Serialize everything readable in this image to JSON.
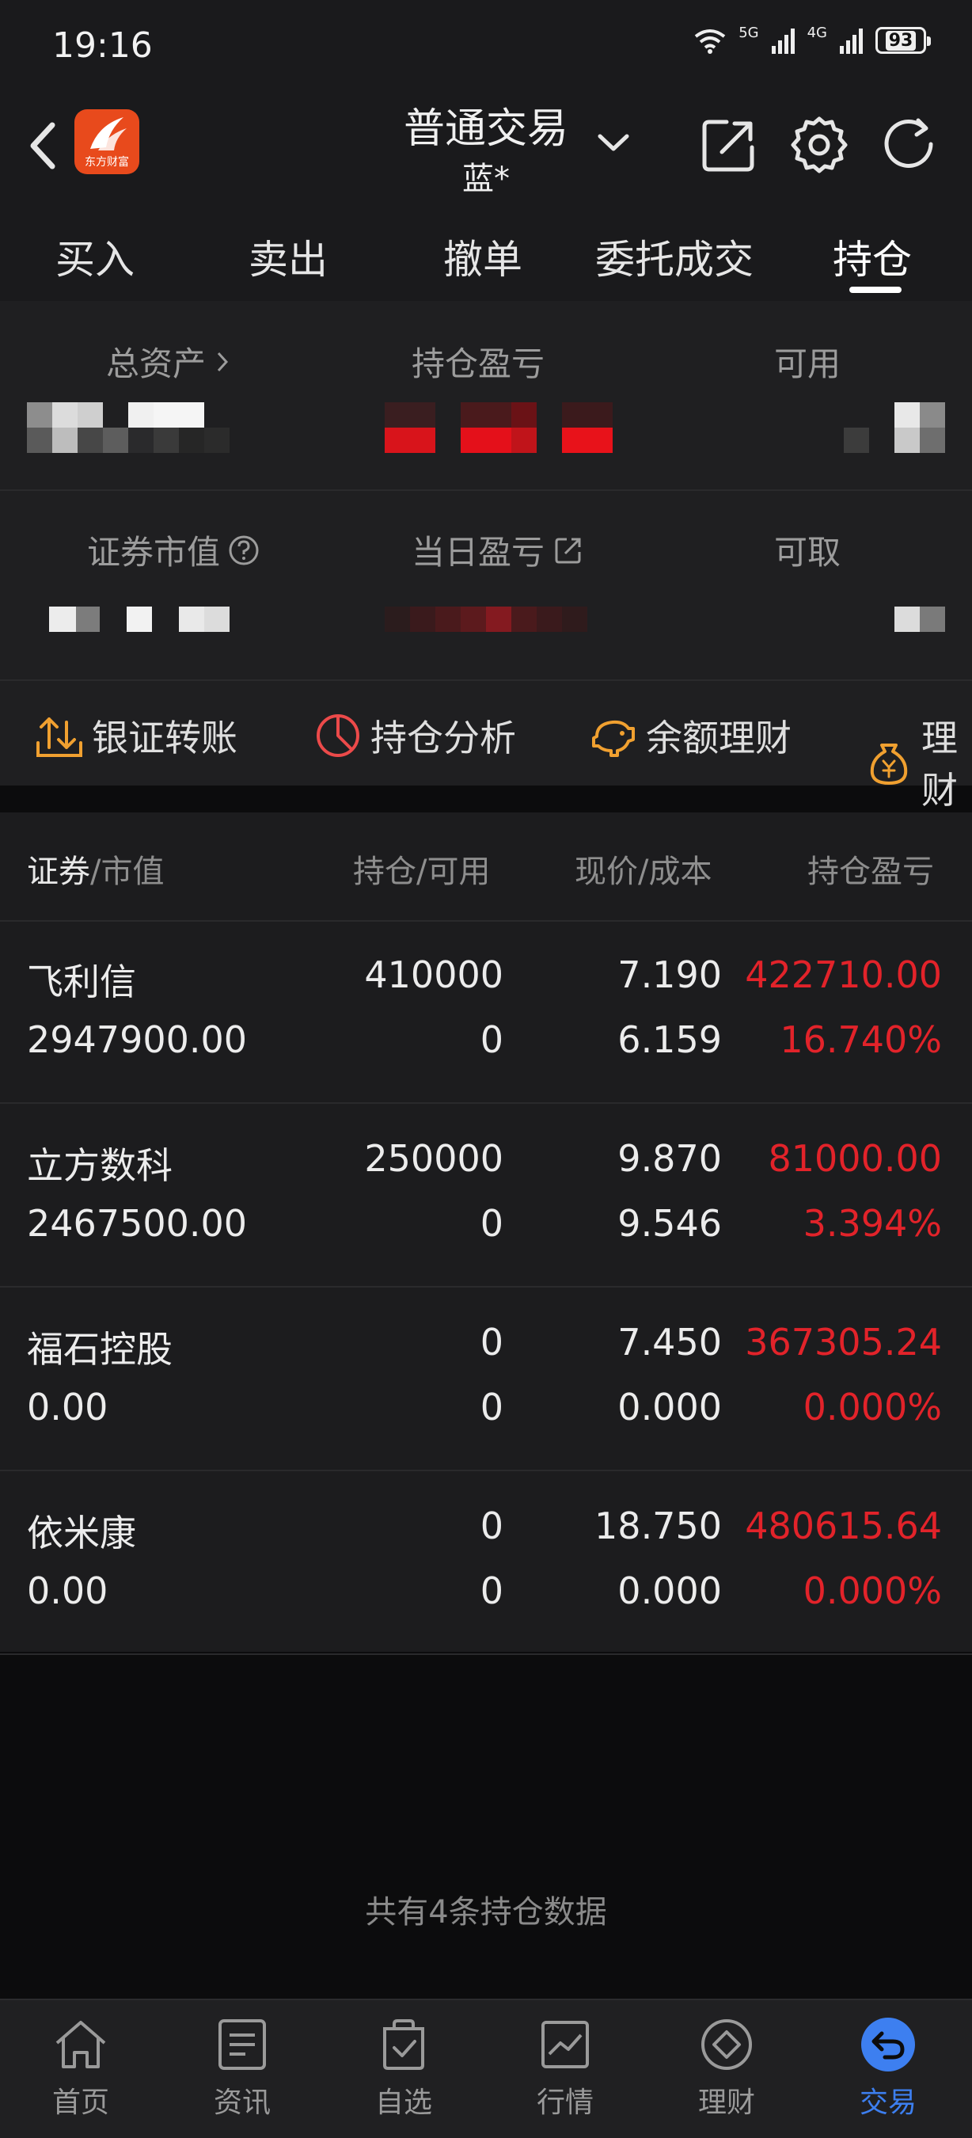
{
  "status_bar": {
    "time": "19:16",
    "net_a": "5G",
    "net_b": "4G",
    "battery": "93"
  },
  "header": {
    "title": "普通交易",
    "subtitle": "蓝*",
    "logo_text": "东方财富"
  },
  "tabs": [
    {
      "label": "买入"
    },
    {
      "label": "卖出"
    },
    {
      "label": "撤单"
    },
    {
      "label": "委托成交"
    },
    {
      "label": "持仓",
      "active": true
    }
  ],
  "summary": {
    "total_assets_label": "总资产",
    "position_pl_label": "持仓盈亏",
    "available_label": "可用",
    "market_value_label": "证券市值",
    "daily_pl_label": "当日盈亏",
    "withdrawable_label": "可取"
  },
  "quick_actions": [
    {
      "label": "银证转账",
      "icon": "transfer-icon"
    },
    {
      "label": "持仓分析",
      "icon": "pie-chart-icon"
    },
    {
      "label": "余额理财",
      "icon": "piggy-bank-icon"
    },
    {
      "label": "理财",
      "icon": "money-bag-icon"
    }
  ],
  "table": {
    "headers": {
      "security": "证券",
      "market_value": "/市值",
      "position": "持仓/可用",
      "price": "现价/成本",
      "pl": "持仓盈亏"
    },
    "rows": [
      {
        "name": "飞利信",
        "value": "2947900.00",
        "position": "410000",
        "available": "0",
        "price": "7.190",
        "cost": "6.159",
        "pl": "422710.00",
        "pl_pct": "16.740%"
      },
      {
        "name": "立方数科",
        "value": "2467500.00",
        "position": "250000",
        "available": "0",
        "price": "9.870",
        "cost": "9.546",
        "pl": "81000.00",
        "pl_pct": "3.394%"
      },
      {
        "name": "福石控股",
        "value": "0.00",
        "position": "0",
        "available": "0",
        "price": "7.450",
        "cost": "0.000",
        "pl": "367305.24",
        "pl_pct": "0.000%"
      },
      {
        "name": "依米康",
        "value": "0.00",
        "position": "0",
        "available": "0",
        "price": "18.750",
        "cost": "0.000",
        "pl": "480615.64",
        "pl_pct": "0.000%"
      }
    ]
  },
  "footer_note": "共有4条持仓数据",
  "bottom_nav": [
    {
      "label": "首页",
      "icon": "home-icon"
    },
    {
      "label": "资讯",
      "icon": "news-icon"
    },
    {
      "label": "自选",
      "icon": "watchlist-icon"
    },
    {
      "label": "行情",
      "icon": "market-chart-icon"
    },
    {
      "label": "理财",
      "icon": "finance-icon"
    },
    {
      "label": "交易",
      "icon": "trade-icon",
      "active": true
    }
  ],
  "colors": {
    "loss_gain_red": "#e2232a",
    "accent_blue": "#3d7ff0",
    "action_orange": "#f0a030",
    "logo_orange": "#e84a1c"
  }
}
